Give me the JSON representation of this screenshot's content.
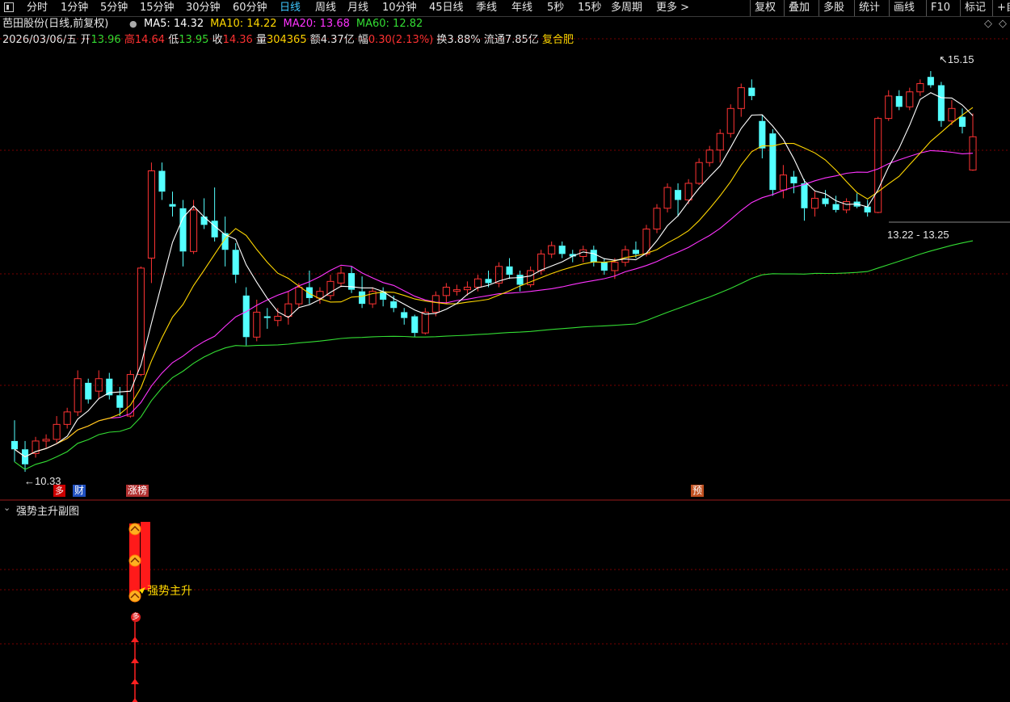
{
  "toolbar": {
    "periods": [
      "分时",
      "1分钟",
      "5分钟",
      "15分钟",
      "30分钟",
      "60分钟",
      "日线",
      "周线",
      "月线",
      "10分钟",
      "45日线",
      "季线",
      "年线",
      "5秒",
      "15秒",
      "多周期",
      "更多 >"
    ],
    "active": "日线",
    "right": [
      "复权",
      "叠加",
      "多股",
      "统计",
      "画线",
      "F10",
      "标记",
      "+自"
    ]
  },
  "header": {
    "stock": "芭田股份(日线,前复权)",
    "ma": [
      {
        "label": "MA5: 14.32",
        "color": "#ffffff"
      },
      {
        "label": "MA10: 14.22",
        "color": "#ffd700"
      },
      {
        "label": "MA20: 13.68",
        "color": "#ff33ff"
      },
      {
        "label": "MA60: 12.82",
        "color": "#33dd33"
      }
    ],
    "date": "2026/03/06/五",
    "open_l": "开",
    "open_v": "13.96",
    "high_l": "高",
    "high_v": "14.64",
    "low_l": "低",
    "low_v": "13.95",
    "close_l": "收",
    "close_v": "14.36",
    "vol_l": "量",
    "vol_v": "304365",
    "amt": "额4.37亿",
    "chg_l": "幅",
    "chg_v": "0.30(2.13%)",
    "turn": "换3.88%",
    "float": "流通7.85亿",
    "region": "复合肥"
  },
  "annotations": {
    "high": "15.15",
    "low": "10.33",
    "range": "13.22 - 13.25"
  },
  "markers": {
    "m1": "多",
    "m2": "财",
    "m3": "涨榜",
    "m4": "预"
  },
  "sub_panel": {
    "title": "强势主升副图",
    "label": "强势主升",
    "dot": "多"
  },
  "colors": {
    "up": "#ff3333",
    "down": "#54ffff",
    "ma5": "#ffffff",
    "ma10": "#ffd700",
    "ma20": "#ff33ff",
    "ma60": "#33dd33",
    "bg": "#000000",
    "grid": "#7a0000"
  },
  "chart_data": {
    "type": "candlestick",
    "price_range": [
      10.33,
      15.15
    ],
    "candles": [
      [
        10.7,
        10.95,
        10.45,
        10.6
      ],
      [
        10.6,
        10.7,
        10.33,
        10.42
      ],
      [
        10.55,
        10.75,
        10.5,
        10.7
      ],
      [
        10.7,
        10.78,
        10.62,
        10.72
      ],
      [
        10.72,
        11.0,
        10.68,
        10.9
      ],
      [
        10.9,
        11.1,
        10.85,
        11.05
      ],
      [
        11.05,
        11.55,
        11.0,
        11.45
      ],
      [
        11.4,
        11.45,
        11.15,
        11.2
      ],
      [
        11.3,
        11.55,
        11.2,
        11.45
      ],
      [
        11.45,
        11.52,
        11.2,
        11.25
      ],
      [
        11.25,
        11.35,
        11.0,
        11.1
      ],
      [
        11.0,
        11.55,
        10.98,
        11.5
      ],
      [
        11.5,
        12.8,
        11.48,
        12.78
      ],
      [
        12.9,
        14.05,
        12.6,
        13.95
      ],
      [
        13.95,
        14.05,
        13.6,
        13.7
      ],
      [
        13.55,
        13.7,
        13.4,
        13.52
      ],
      [
        13.5,
        13.6,
        12.8,
        12.98
      ],
      [
        12.98,
        13.6,
        12.95,
        13.48
      ],
      [
        13.4,
        13.62,
        13.25,
        13.3
      ],
      [
        13.35,
        13.75,
        13.1,
        13.15
      ],
      [
        13.2,
        13.4,
        12.8,
        13.0
      ],
      [
        13.0,
        13.08,
        12.6,
        12.7
      ],
      [
        12.45,
        12.55,
        11.85,
        11.95
      ],
      [
        11.95,
        12.4,
        11.9,
        12.25
      ],
      [
        12.2,
        12.3,
        12.05,
        12.18
      ],
      [
        12.15,
        12.3,
        12.08,
        12.2
      ],
      [
        12.2,
        12.5,
        12.1,
        12.35
      ],
      [
        12.35,
        12.6,
        12.3,
        12.55
      ],
      [
        12.55,
        12.75,
        12.35,
        12.42
      ],
      [
        12.42,
        12.55,
        12.35,
        12.5
      ],
      [
        12.45,
        12.7,
        12.4,
        12.62
      ],
      [
        12.6,
        12.8,
        12.55,
        12.72
      ],
      [
        12.72,
        12.8,
        12.48,
        12.52
      ],
      [
        12.5,
        12.68,
        12.3,
        12.35
      ],
      [
        12.35,
        12.55,
        12.3,
        12.5
      ],
      [
        12.5,
        12.55,
        12.32,
        12.4
      ],
      [
        12.38,
        12.45,
        12.25,
        12.3
      ],
      [
        12.25,
        12.3,
        12.1,
        12.18
      ],
      [
        12.2,
        12.22,
        11.95,
        12.0
      ],
      [
        12.0,
        12.3,
        11.98,
        12.25
      ],
      [
        12.25,
        12.5,
        12.2,
        12.45
      ],
      [
        12.45,
        12.6,
        12.35,
        12.55
      ],
      [
        12.5,
        12.58,
        12.45,
        12.52
      ],
      [
        12.52,
        12.62,
        12.45,
        12.55
      ],
      [
        12.55,
        12.7,
        12.5,
        12.65
      ],
      [
        12.65,
        12.75,
        12.55,
        12.6
      ],
      [
        12.6,
        12.85,
        12.55,
        12.8
      ],
      [
        12.8,
        12.9,
        12.65,
        12.7
      ],
      [
        12.7,
        12.75,
        12.5,
        12.58
      ],
      [
        12.58,
        12.8,
        12.55,
        12.75
      ],
      [
        12.75,
        13.0,
        12.7,
        12.95
      ],
      [
        12.95,
        13.1,
        12.9,
        13.05
      ],
      [
        13.05,
        13.1,
        12.9,
        12.95
      ],
      [
        12.95,
        13.0,
        12.85,
        12.92
      ],
      [
        12.92,
        13.05,
        12.85,
        13.0
      ],
      [
        13.0,
        13.05,
        12.8,
        12.85
      ],
      [
        12.85,
        12.9,
        12.7,
        12.75
      ],
      [
        12.75,
        12.9,
        12.65,
        12.85
      ],
      [
        12.85,
        13.05,
        12.8,
        13.0
      ],
      [
        13.0,
        13.1,
        12.9,
        12.95
      ],
      [
        12.95,
        13.3,
        12.92,
        13.25
      ],
      [
        13.25,
        13.55,
        13.2,
        13.5
      ],
      [
        13.5,
        13.8,
        13.45,
        13.75
      ],
      [
        13.72,
        13.8,
        13.4,
        13.6
      ],
      [
        13.6,
        13.85,
        13.55,
        13.8
      ],
      [
        13.8,
        14.1,
        13.78,
        14.05
      ],
      [
        14.05,
        14.25,
        14.0,
        14.2
      ],
      [
        14.2,
        14.45,
        14.05,
        14.4
      ],
      [
        14.4,
        14.75,
        14.35,
        14.7
      ],
      [
        14.7,
        15.0,
        14.6,
        14.95
      ],
      [
        14.95,
        15.05,
        14.8,
        14.85
      ],
      [
        14.55,
        14.62,
        14.1,
        14.22
      ],
      [
        14.4,
        14.45,
        13.65,
        13.72
      ],
      [
        13.72,
        14.02,
        13.62,
        13.9
      ],
      [
        13.88,
        13.95,
        13.68,
        13.8
      ],
      [
        13.8,
        13.85,
        13.35,
        13.5
      ],
      [
        13.5,
        13.7,
        13.4,
        13.62
      ],
      [
        13.62,
        13.72,
        13.52,
        13.55
      ],
      [
        13.55,
        13.65,
        13.45,
        13.48
      ],
      [
        13.48,
        13.62,
        13.44,
        13.58
      ],
      [
        13.58,
        13.68,
        13.5,
        13.52
      ],
      [
        13.52,
        13.6,
        13.4,
        13.45
      ],
      [
        13.45,
        14.6,
        13.44,
        14.58
      ],
      [
        14.58,
        14.92,
        14.55,
        14.85
      ],
      [
        14.85,
        14.92,
        14.68,
        14.72
      ],
      [
        14.72,
        14.95,
        14.68,
        14.9
      ],
      [
        14.9,
        15.05,
        14.85,
        15.0
      ],
      [
        15.08,
        15.15,
        14.95,
        14.98
      ],
      [
        14.98,
        15.02,
        14.48,
        14.55
      ],
      [
        14.55,
        14.8,
        14.5,
        14.7
      ],
      [
        14.6,
        14.7,
        14.4,
        14.48
      ],
      [
        13.96,
        14.64,
        13.95,
        14.36
      ]
    ]
  }
}
